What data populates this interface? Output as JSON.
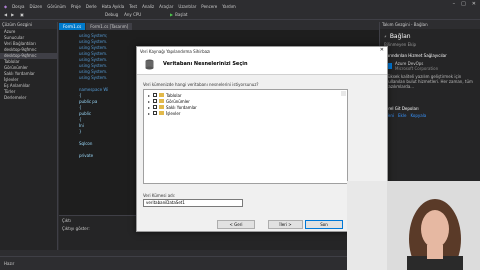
{
  "menu": [
    "Dosya",
    "Düzen",
    "Görünüm",
    "Proje",
    "Derle",
    "Hata Ayıkla",
    "Test",
    "Analiz",
    "Araçlar",
    "Uzantılar",
    "Pencere",
    "Yardım"
  ],
  "toolbar": {
    "config": "Debug",
    "platform": "Any CPU",
    "start_label": "Başlat"
  },
  "solution_explorer": {
    "title": "Çözüm Gezgini",
    "items": [
      {
        "label": "Azure"
      },
      {
        "label": "Sunucular"
      },
      {
        "label": "Veri Bağlantıları"
      },
      {
        "label": "desktop-9qfmnc"
      },
      {
        "label": "desktop-9qfmnc",
        "selected": true
      },
      {
        "label": "Tablolar"
      },
      {
        "label": "Görünümler"
      },
      {
        "label": "Saklı Yordamlar"
      },
      {
        "label": "İşlevler"
      },
      {
        "label": "Eş Anlamlılar"
      },
      {
        "label": "Türler"
      },
      {
        "label": "Derlemeler"
      }
    ]
  },
  "editor": {
    "tabs": [
      {
        "label": "Form1.cs",
        "active": true
      },
      {
        "label": "Form1.cs [Tasarım]",
        "active": false
      }
    ],
    "lines": [
      "using System;",
      "using System.",
      "using System.",
      "using System.",
      "using System.",
      "using System.",
      "using System.",
      "using System.",
      "",
      "namespace Wi",
      "{",
      "  public pa",
      "  {",
      "    public",
      "    {",
      "      Ini",
      "    }",
      "",
      "    Sqlcon",
      "",
      "    private"
    ]
  },
  "output": {
    "title": "Çıktı",
    "source_label": "Çıktıyı göster:"
  },
  "dialog": {
    "window_title": "Veri Kaynağı Yapılandırma Sihirbazı",
    "heading": "Veritabanı Nesnelerinizi Seçin",
    "question": "Veri kümenizde hangi veritabanı nesnelerini istiyorsunuz?",
    "tree": [
      {
        "label": "Tablolar"
      },
      {
        "label": "Görünümler"
      },
      {
        "label": "Saklı Yordamlar"
      },
      {
        "label": "İşlevler"
      }
    ],
    "dataset_label": "Veri Kümesi adı:",
    "dataset_name": "veritabaniDataSet1",
    "buttons": {
      "back": "< Geri",
      "next": "İleri >",
      "finish": "Son",
      "cancel": "İptal"
    }
  },
  "right_panel": {
    "title": "Takım Gezgini - Bağlan",
    "connect": "Bağlan",
    "subtitle": "Bilinmeyen Ekip",
    "section": "Barındırılan Hizmet Sağlayıcılar",
    "service_name": "Azure DevOps",
    "service_sub": "Microsoft Corporation",
    "description": "Yüksek kaliteli yazılım geliştirmek için kullanılan bulut hizmetleri. Her zaman, tüm yazılımlarda...",
    "local_section": "Yerel Git Depoları",
    "local_actions": [
      "Yeni",
      "Ekle",
      "Kopyala"
    ],
    "status": "Etkin"
  },
  "status_bar": {
    "ready": "Hazır",
    "right": "Kaynak denetimine ekle"
  },
  "colors": {
    "accent": "#007acc",
    "background": "#2d2d30",
    "editor_bg": "#1e1e1e"
  }
}
